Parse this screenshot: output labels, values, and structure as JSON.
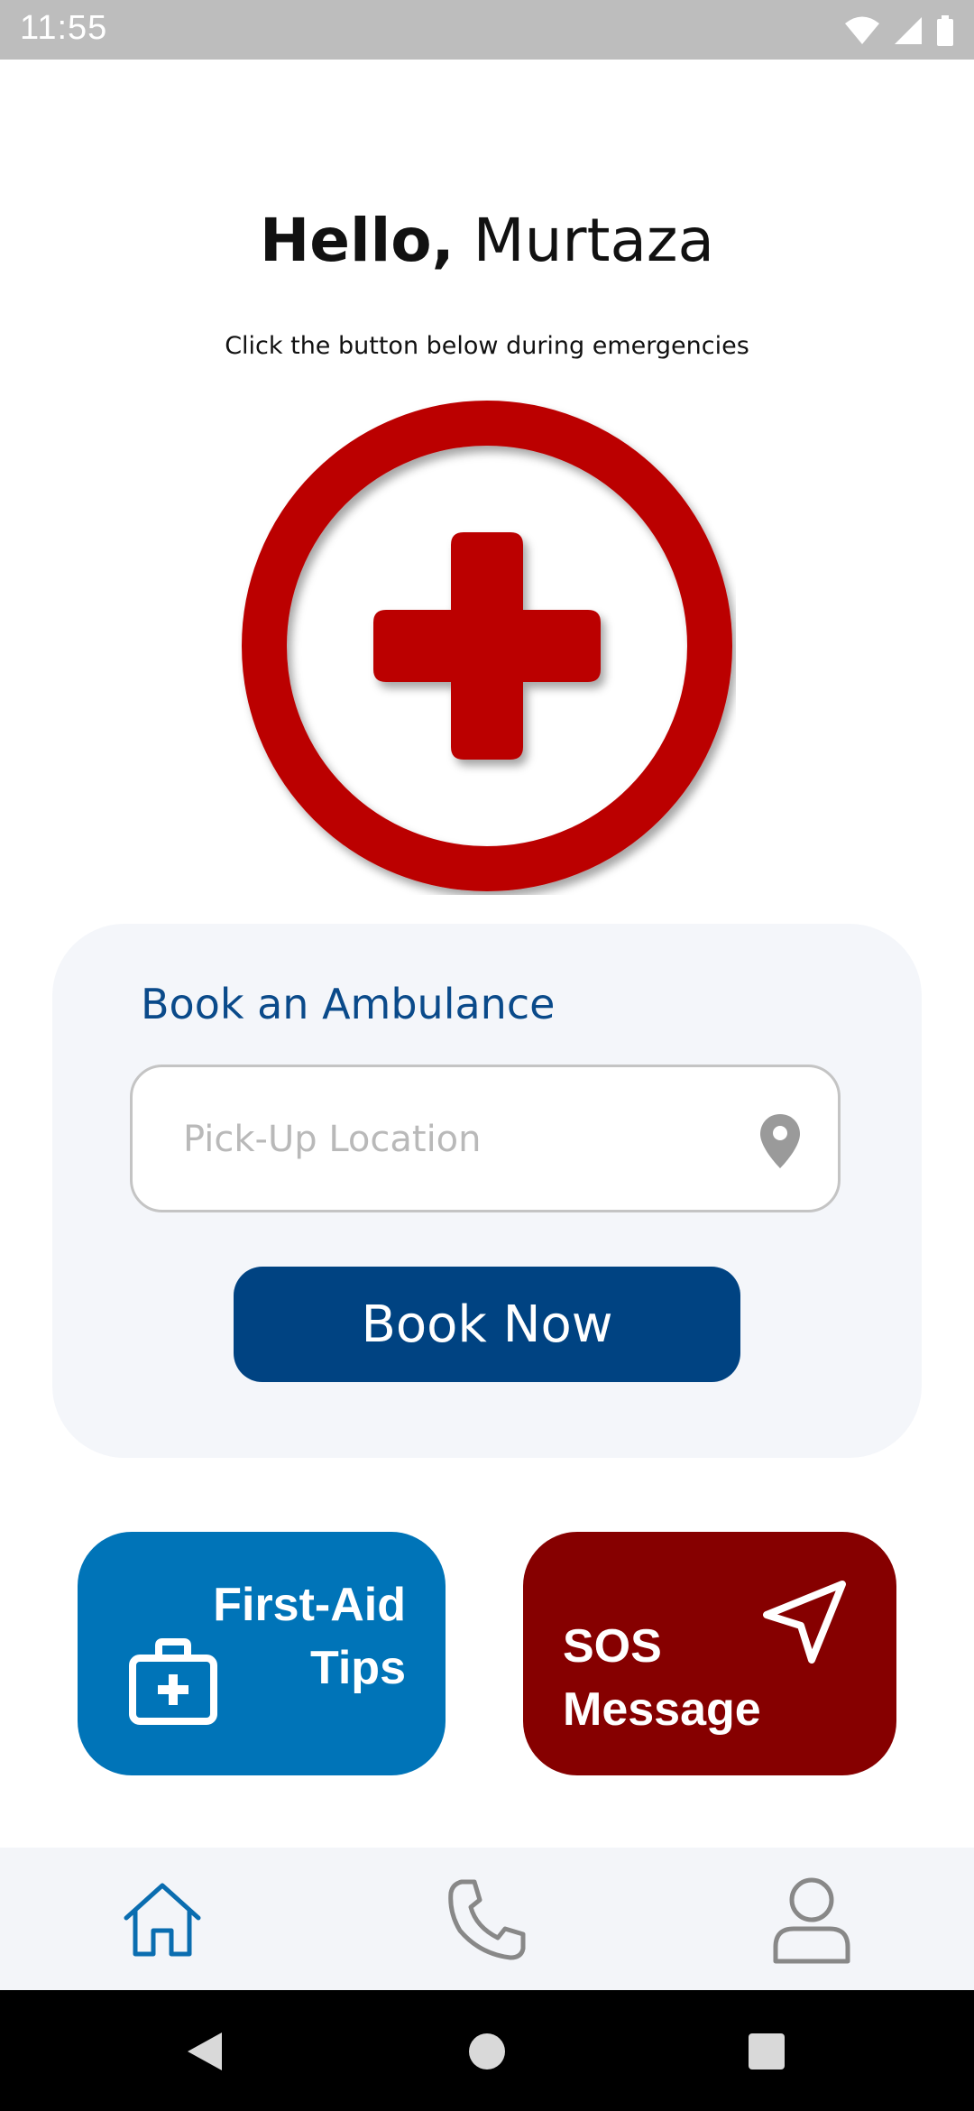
{
  "status_bar": {
    "time": "11:55",
    "icons": [
      "wifi-icon",
      "signal-icon",
      "battery-icon"
    ]
  },
  "greeting": {
    "hello": "Hello,",
    "name": "Murtaza"
  },
  "subtitle": "Click the button below during emergencies",
  "emergency_button": {
    "icon": "red-cross-icon",
    "color": "#bb0000"
  },
  "book_card": {
    "title": "Book an Ambulance",
    "pickup_placeholder": "Pick-Up Location",
    "pickup_value": "",
    "pickup_icon": "location-pin-icon",
    "button_label": "Book Now",
    "button_color": "#004382"
  },
  "tiles": {
    "first_aid": {
      "line1": "First-Aid",
      "line2": "Tips",
      "icon": "first-aid-kit-icon",
      "color": "#0074b8"
    },
    "sos": {
      "line1": "SOS",
      "line2": "Message",
      "icon": "send-icon",
      "color": "#860000"
    }
  },
  "bottom_nav": {
    "items": [
      {
        "name": "home",
        "icon": "home-icon",
        "active": true,
        "active_color": "#0a6db0"
      },
      {
        "name": "call",
        "icon": "phone-icon",
        "active": false
      },
      {
        "name": "profile",
        "icon": "user-icon",
        "active": false
      }
    ]
  },
  "system_nav": [
    "back-icon",
    "home-circle-icon",
    "recents-icon"
  ]
}
